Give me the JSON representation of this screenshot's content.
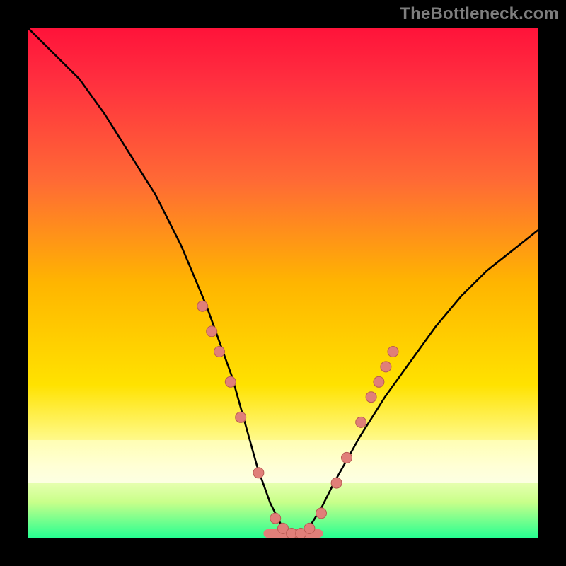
{
  "watermark": {
    "text": "TheBottleneck.com"
  },
  "palette": {
    "grad_top": "#ff1f3d",
    "grad_mid": "#ffd600",
    "grad_bot": "#1cff8e",
    "band_white_top": "#ffffa8",
    "band_white_bot": "#ffffe2",
    "curve": "#000000",
    "dot_fill": "#e07f79",
    "dot_stroke": "#b85a52"
  },
  "chart_data": {
    "type": "line",
    "title": "",
    "xlabel": "",
    "ylabel": "",
    "x": [
      0,
      0.05,
      0.1,
      0.15,
      0.2,
      0.25,
      0.3,
      0.35,
      0.375,
      0.4,
      0.425,
      0.45,
      0.475,
      0.5,
      0.525,
      0.55,
      0.575,
      0.6,
      0.65,
      0.7,
      0.75,
      0.8,
      0.85,
      0.9,
      0.95,
      1.0
    ],
    "y": [
      100,
      95,
      90,
      83,
      75,
      67,
      57,
      45,
      38,
      31,
      22,
      13,
      6,
      1,
      0,
      1,
      5,
      10,
      19,
      27,
      34,
      41,
      47,
      52,
      56,
      60
    ],
    "x_range": [
      0,
      1
    ],
    "y_range": [
      0,
      100
    ],
    "dots": [
      {
        "x": 0.342,
        "y": 45
      },
      {
        "x": 0.36,
        "y": 40
      },
      {
        "x": 0.375,
        "y": 36
      },
      {
        "x": 0.397,
        "y": 30
      },
      {
        "x": 0.417,
        "y": 23
      },
      {
        "x": 0.452,
        "y": 12
      },
      {
        "x": 0.485,
        "y": 3
      },
      {
        "x": 0.5,
        "y": 1
      },
      {
        "x": 0.517,
        "y": 0
      },
      {
        "x": 0.535,
        "y": 0
      },
      {
        "x": 0.552,
        "y": 1
      },
      {
        "x": 0.575,
        "y": 4
      },
      {
        "x": 0.605,
        "y": 10
      },
      {
        "x": 0.625,
        "y": 15
      },
      {
        "x": 0.653,
        "y": 22
      },
      {
        "x": 0.673,
        "y": 27
      },
      {
        "x": 0.688,
        "y": 30
      },
      {
        "x": 0.702,
        "y": 33
      },
      {
        "x": 0.716,
        "y": 36
      }
    ],
    "bottom_bar": {
      "x_start": 0.47,
      "x_end": 0.57,
      "y": 0
    }
  }
}
